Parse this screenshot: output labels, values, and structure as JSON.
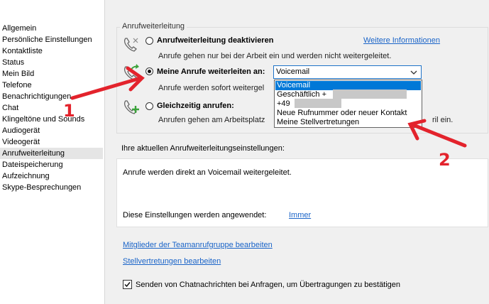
{
  "sidebar": {
    "items": [
      {
        "label": "Allgemein"
      },
      {
        "label": "Persönliche Einstellungen"
      },
      {
        "label": "Kontaktliste"
      },
      {
        "label": "Status"
      },
      {
        "label": "Mein Bild"
      },
      {
        "label": "Telefone"
      },
      {
        "label": "Benachrichtigungen"
      },
      {
        "label": "Chat"
      },
      {
        "label": "Klingeltöne und Sounds"
      },
      {
        "label": "Audiogerät"
      },
      {
        "label": "Videogerät"
      },
      {
        "label": "Anrufweiterleitung"
      },
      {
        "label": "Dateispeicherung"
      },
      {
        "label": "Aufzeichnung"
      },
      {
        "label": "Skype-Besprechungen"
      }
    ],
    "selected": "Anrufweiterleitung"
  },
  "forwarding": {
    "group_title": "Anrufweiterleitung",
    "more_info_link": "Weitere Informationen",
    "options": [
      {
        "label": "Anrufweiterleitung deaktivieren",
        "description": "Anrufe gehen nur bei der Arbeit ein und werden nicht weitergeleitet.",
        "checked": false,
        "icon": "phone-off-icon"
      },
      {
        "label": "Meine Anrufe weiterleiten an:",
        "description": "Anrufe werden sofort weitergel",
        "checked": true,
        "icon": "phone-forward-icon"
      },
      {
        "label": "Gleichzeitig anrufen:",
        "description": "Anrufen gehen am Arbeitsplatz",
        "description_tail": "ril ein.",
        "checked": false,
        "icon": "phone-add-icon"
      }
    ],
    "combo": {
      "selected": "Voicemail",
      "options": [
        "Voicemail",
        "Geschäftlich +",
        "+49",
        "Neue Rufnummer oder neuer Kontakt",
        "Meine Stellvertretungen"
      ]
    }
  },
  "current_settings": {
    "heading": "Ihre aktuellen Anrufweiterleitungseinstellungen:",
    "text": "Anrufe werden direkt an Voicemail weitergeleitet.",
    "applied_label": "Diese Einstellungen werden angewendet:",
    "applied_value": "Immer"
  },
  "links": {
    "team_group": "Mitglieder der Teamanrufgruppe bearbeiten",
    "delegates": "Stellvertretungen bearbeiten"
  },
  "chat_checkbox": {
    "label": "Senden von Chatnachrichten bei Anfragen, um Übertragungen zu bestätigen",
    "checked": true
  },
  "annotations": {
    "marker_1": "1",
    "marker_2": "2",
    "color": "#e3232c"
  },
  "colors": {
    "accent": "#0078d7",
    "link": "#1a64c8",
    "green_arrow": "#3aa33a"
  }
}
